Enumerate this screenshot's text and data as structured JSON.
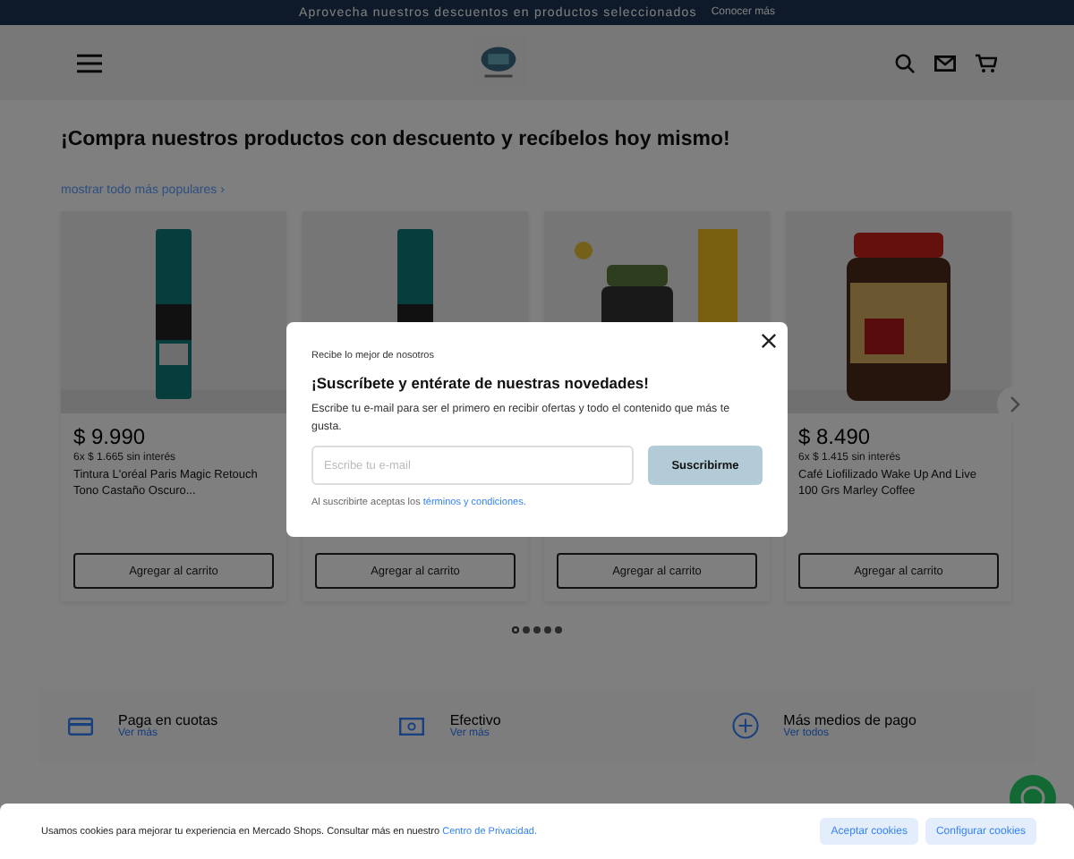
{
  "banner": {
    "text": "Aprovecha nuestros descuentos en productos seleccionados",
    "link": "Conocer más"
  },
  "heading": "¡Compra nuestros productos con descuento y recíbelos hoy mismo!",
  "show_all_link": "mostrar todo más populares ›",
  "products": [
    {
      "kind": "spray",
      "price": "$ 9.990",
      "installments": "6x $ 1.665 sin interés",
      "title": "Tintura L'oréal Paris Magic Retouch Tono Castaño Oscuro...",
      "button": "Agregar al carrito"
    },
    {
      "kind": "spray",
      "button": "Agregar al carrito"
    },
    {
      "kind": "jar",
      "button": "Agregar al carrito"
    },
    {
      "kind": "coffee",
      "price": "$ 8.490",
      "installments": "6x $ 1.415 sin interés",
      "title": "Café Liofilizado Wake Up And Live 100 Grs Marley Coffee",
      "button": "Agregar al carrito"
    }
  ],
  "dots": [
    {
      "selected": true
    },
    {
      "selected": false
    },
    {
      "selected": false
    },
    {
      "selected": false
    },
    {
      "selected": false
    }
  ],
  "payments": [
    {
      "kind": "card",
      "title": "Paga en cuotas",
      "link": "Ver más"
    },
    {
      "kind": "cash",
      "title": "Efectivo",
      "link": "Ver más"
    },
    {
      "kind": "plus",
      "title": "Más medios de pago",
      "link": "Ver todos"
    }
  ],
  "modal": {
    "eyebrow": "Recibe lo mejor de nosotros",
    "title": "¡Suscríbete y entérate de nuestras novedades!",
    "body": "Escribe tu e-mail para ser el primero en recibir ofertas y todo el contenido que más te gusta.",
    "placeholder": "Escribe tu e-mail",
    "button": "Suscribirme",
    "terms_prefix": "Al suscribirte aceptas los",
    "terms_link": "términos y condiciones."
  },
  "cookies": {
    "text": "Usamos cookies para mejorar tu experiencia en Mercado Shops. Consultar más en nuestro",
    "link": "Centro de Privacidad.",
    "buttons": [
      "Aceptar cookies",
      "Configurar cookies"
    ]
  }
}
